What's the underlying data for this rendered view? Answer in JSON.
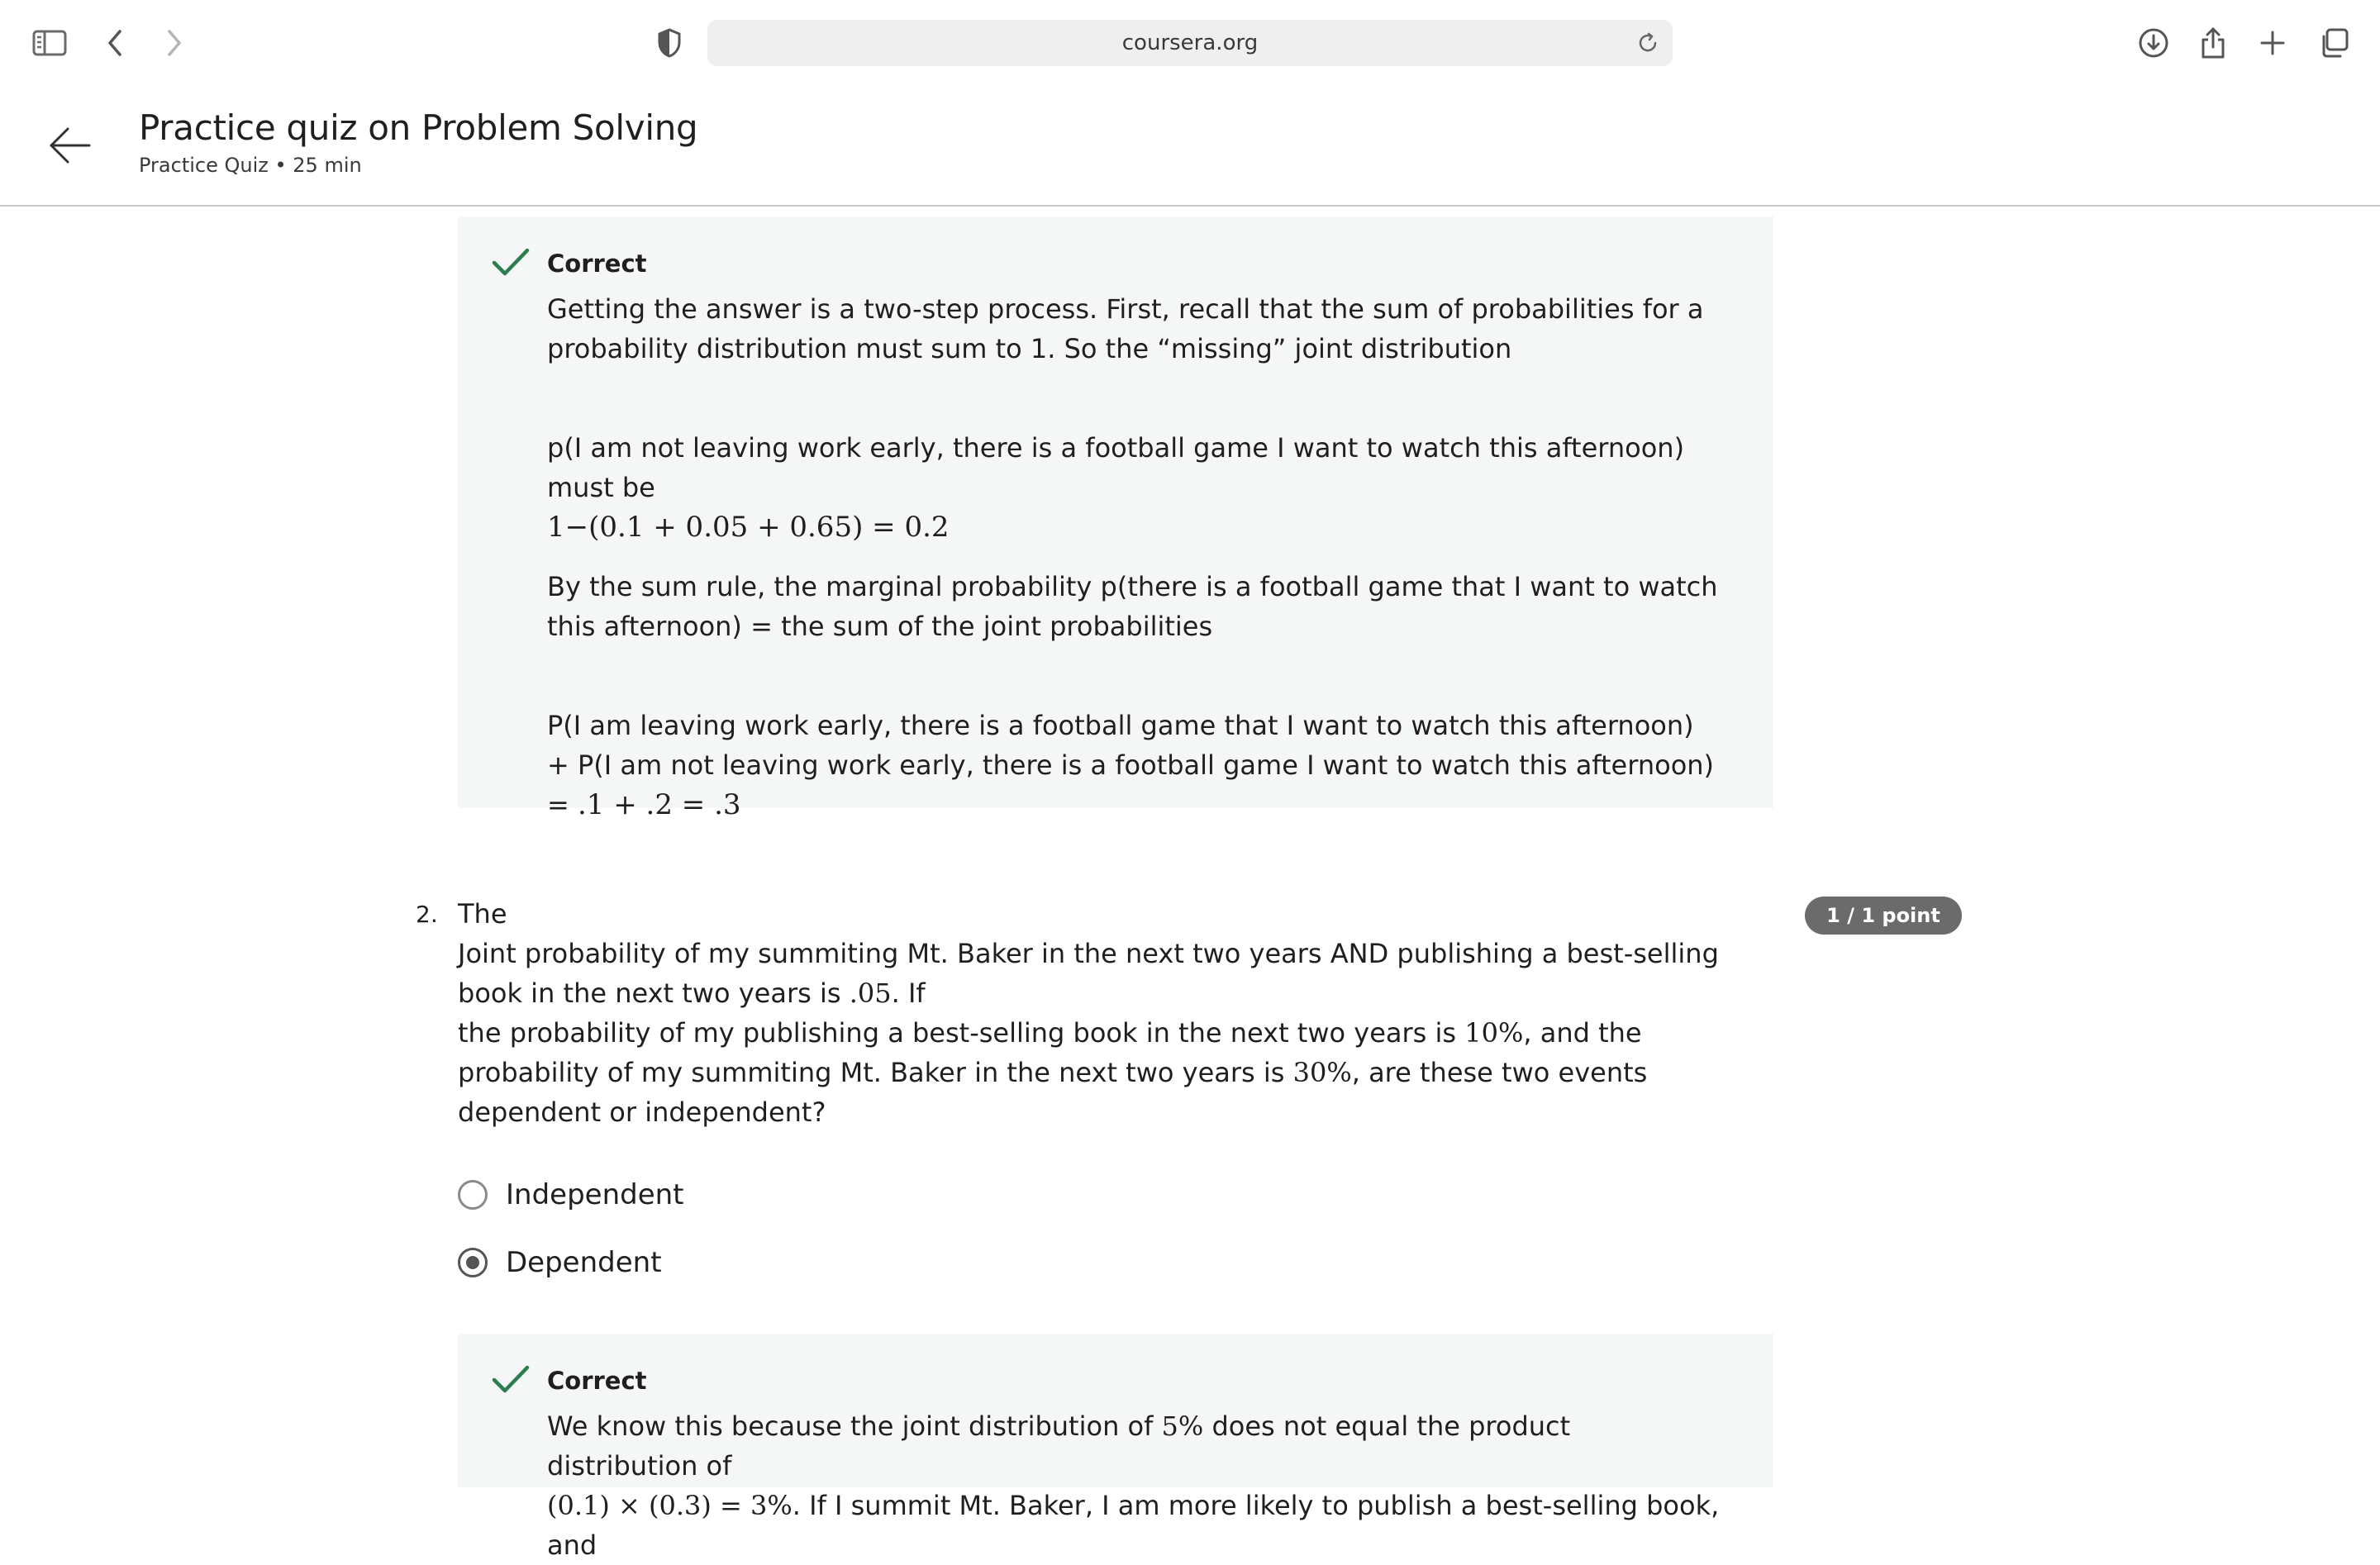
{
  "browser": {
    "url": "coursera.org",
    "icons": [
      "sidebar-icon",
      "back-chevron-icon",
      "forward-chevron-icon",
      "privacy-shield-icon",
      "reload-icon",
      "download-icon",
      "share-icon",
      "new-tab-plus-icon",
      "tabs-overview-icon"
    ]
  },
  "header": {
    "title": "Practice quiz on Problem Solving",
    "subtitle": "Practice Quiz • 25 min"
  },
  "feedback1": {
    "status": "Correct",
    "para1": "Getting the answer is a two-step process. First, recall that the sum of probabilities for a probability distribution must sum to 1. So the “missing” joint distribution",
    "para2_text": "p(I am not leaving work early, there is a football game I want to watch this afternoon) must be",
    "para2_math": "1−(0.1 + 0.05 + 0.65) = 0.2",
    "para3": "By the sum rule, the marginal probability p(there is a football game that I want to watch this afternoon) = the sum of the joint probabilities",
    "para4_text": "P(I am leaving work early, there is a football game that I want to watch this afternoon) + P(I am not leaving work early, there is a football game I want to watch this afternoon) =",
    "para4_math": ".1 + .2 = .3"
  },
  "question2": {
    "number": "2.",
    "badge": "1 / 1 point",
    "line1": "The",
    "line2a": "Joint probability of my summiting Mt. Baker in the next two years AND publishing a best-selling book in the next two years is",
    "line2_math": ".05",
    "line2b": ". If",
    "line3a": "the probability of my publishing a best-selling book in the next two years is",
    "line3_math1": "10%",
    "line3b": ", and the probability of my summiting Mt. Baker in the next two years is",
    "line3_math2": "30%",
    "line3c": ", are these two events dependent or independent?",
    "options": [
      {
        "label": "Independent",
        "selected": false
      },
      {
        "label": "Dependent",
        "selected": true
      }
    ]
  },
  "feedback2": {
    "status": "Correct",
    "text_a": "We know this because the joint distribution of",
    "math_a": "5%",
    "text_b": "does not equal the product distribution of",
    "math_b": "(0.1) × (0.3) = 3%",
    "text_c": ". If I summit Mt. Baker, I am more likely to publish a best-selling book, and"
  },
  "colors": {
    "check_green": "#2e7d4f",
    "feedback_bg": "#f5f7f6",
    "badge_bg": "#6b6b6b"
  }
}
